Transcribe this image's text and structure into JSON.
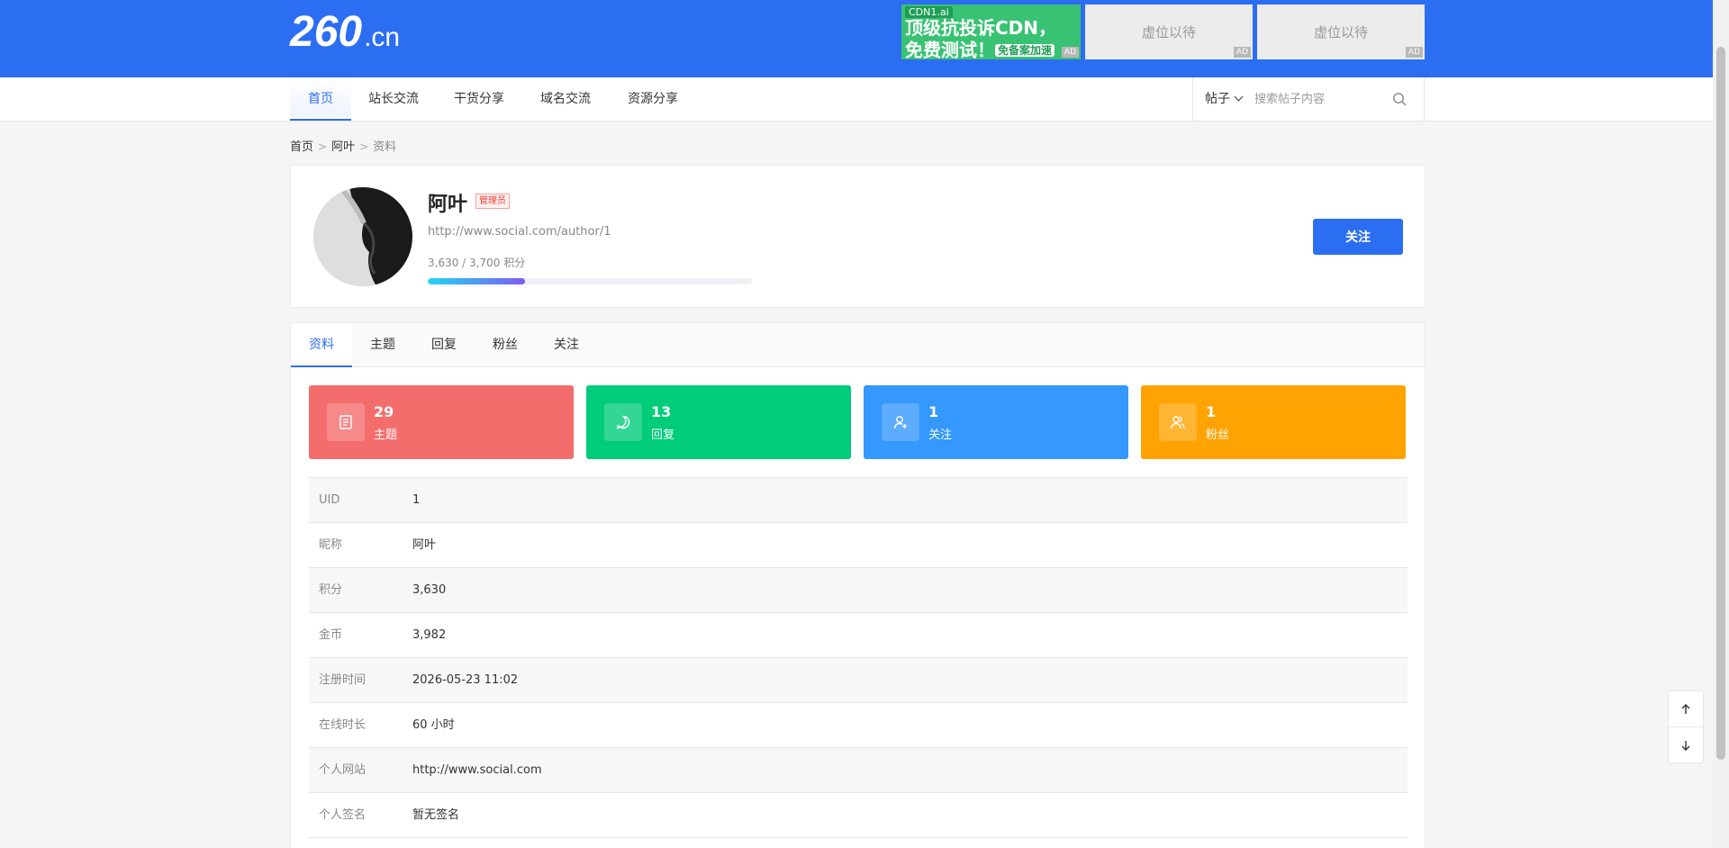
{
  "site": {
    "logo_main": "260",
    "logo_tld": ".cn"
  },
  "ads": {
    "cdn": {
      "brand": "CDN1.ai",
      "line1": "顶级抗投诉CDN，",
      "line2": "免费测试！",
      "tag_text": "免备案加速"
    },
    "slot1": "虚位以待",
    "slot2": "虚位以待",
    "ad_tag": "AD"
  },
  "nav": {
    "items": [
      {
        "label": "首页"
      },
      {
        "label": "站长交流"
      },
      {
        "label": "干货分享"
      },
      {
        "label": "域名交流"
      },
      {
        "label": "资源分享"
      }
    ],
    "active_index": 0
  },
  "search": {
    "type": "帖子",
    "placeholder": "搜索帖子内容",
    "value": ""
  },
  "breadcrumb": {
    "home": "首页",
    "user": "阿叶",
    "current": "资料"
  },
  "profile": {
    "name": "阿叶",
    "role_badge": "管理员",
    "url": "http://www.social.com/author/1",
    "points_text": "3,630 / 3,700 积分",
    "progress_fraction": 0.3,
    "follow_label": "关注"
  },
  "tabs": [
    {
      "label": "资料"
    },
    {
      "label": "主题"
    },
    {
      "label": "回复"
    },
    {
      "label": "粉丝"
    },
    {
      "label": "关注"
    }
  ],
  "stats": [
    {
      "value": "29",
      "label": "主题",
      "color": "#f46d6d",
      "icon": "document-icon"
    },
    {
      "value": "13",
      "label": "回复",
      "color": "#00cc7a",
      "icon": "chat-bubble-icon"
    },
    {
      "value": "1",
      "label": "关注",
      "color": "#3598fd",
      "icon": "user-add-icon"
    },
    {
      "value": "1",
      "label": "粉丝",
      "color": "#ffa302",
      "icon": "users-icon"
    }
  ],
  "info": [
    {
      "key": "UID",
      "value": "1"
    },
    {
      "key": "昵称",
      "value": "阿叶"
    },
    {
      "key": "积分",
      "value": "3,630"
    },
    {
      "key": "金币",
      "value": "3,982"
    },
    {
      "key": "注册时间",
      "value": "2026-05-23 11:02"
    },
    {
      "key": "在线时长",
      "value": "60 小时"
    },
    {
      "key": "个人网站",
      "value": "http://www.social.com"
    },
    {
      "key": "个人签名",
      "value": "暂无签名"
    }
  ],
  "colors": {
    "primary": "#2c6ef2"
  }
}
